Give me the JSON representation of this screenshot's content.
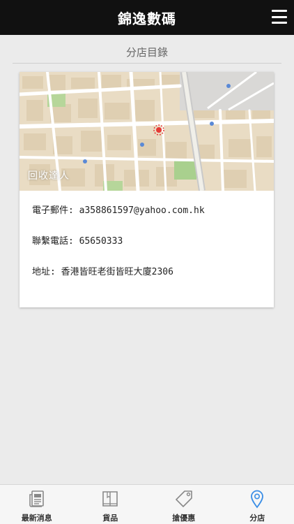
{
  "header": {
    "title": "錦逸數碼"
  },
  "section": {
    "title": "分店目錄"
  },
  "branch": {
    "map_caption": "回收達人",
    "email": "電子郵件: a358861597@yahoo.com.hk",
    "phone": "聯繫電話: 65650333",
    "address": "地址: 香港皆旺老街皆旺大廈2306"
  },
  "tabs": [
    {
      "label": "最新消息",
      "icon": "newspaper-icon"
    },
    {
      "label": "貨品",
      "icon": "book-icon"
    },
    {
      "label": "搶優惠",
      "icon": "tag-icon"
    },
    {
      "label": "分店",
      "icon": "location-pin-icon",
      "active": true
    }
  ],
  "colors": {
    "header_bg": "#111111",
    "page_bg": "#ebebeb",
    "tab_active": "#3a8ee6",
    "tab_inactive": "#888888"
  }
}
